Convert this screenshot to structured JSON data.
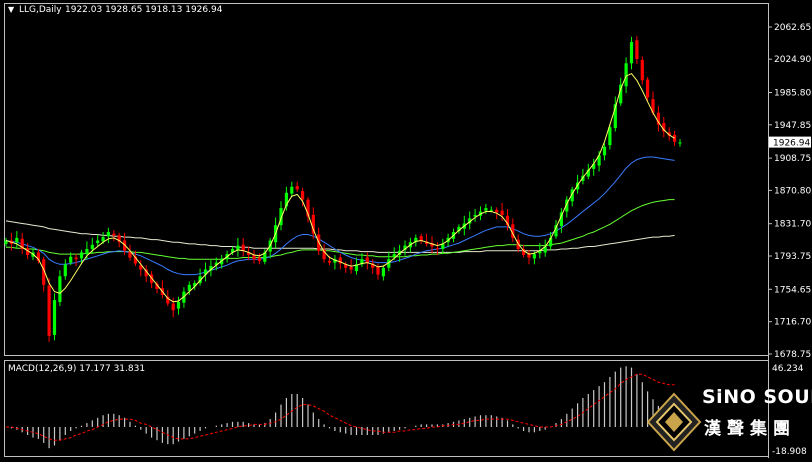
{
  "header": {
    "symbol_label": "LLG,Daily",
    "ohlc_text": "1922.03 1928.65 1918.13 1926.94",
    "menu_glyph": "▼"
  },
  "price_scale": {
    "ticks": [
      "2062.65",
      "2024.90",
      "1985.80",
      "1947.85",
      "1908.75",
      "1870.80",
      "1831.70",
      "1793.75",
      "1754.65",
      "1716.70",
      "1678.75"
    ],
    "current_price": "1926.94"
  },
  "macd": {
    "label": "MACD(12,26,9) 17.177 31.831",
    "scale_top": "46.234",
    "scale_bottom": "-18.908"
  },
  "watermark": {
    "title": "SiNO SOUND",
    "subtitle": "漢聲集團",
    "logo_icon": "diamond-logo-icon"
  },
  "colors": {
    "background": "#000000",
    "bull_candle": "#00ff00",
    "bear_candle": "#ff0000",
    "ma_fast": "#ffff66",
    "ma_blue": "#3a7bff",
    "ma_green": "#66ff33",
    "ma_slow": "#e8e8d0",
    "macd_signal": "#ff0000",
    "macd_hist": "#c8c8c8",
    "grid_border": "#c0c0c0"
  },
  "chart_data": {
    "type": "candlestick",
    "symbol": "LLG",
    "timeframe": "Daily",
    "ylim": [
      1678.75,
      2062.65
    ],
    "last": {
      "open": 1922.03,
      "high": 1928.65,
      "low": 1918.13,
      "close": 1926.94
    },
    "close_path": [
      1812,
      1808,
      1815,
      1802,
      1795,
      1798,
      1788,
      1760,
      1700,
      1742,
      1770,
      1784,
      1793,
      1790,
      1798,
      1802,
      1807,
      1812,
      1816,
      1822,
      1818,
      1810,
      1800,
      1792,
      1785,
      1778,
      1770,
      1762,
      1755,
      1748,
      1738,
      1730,
      1740,
      1752,
      1760,
      1762,
      1770,
      1778,
      1782,
      1786,
      1790,
      1796,
      1802,
      1806,
      1800,
      1795,
      1790,
      1788,
      1798,
      1812,
      1830,
      1850,
      1868,
      1875,
      1872,
      1860,
      1840,
      1820,
      1800,
      1790,
      1786,
      1790,
      1785,
      1780,
      1778,
      1784,
      1790,
      1786,
      1780,
      1772,
      1780,
      1790,
      1796,
      1800,
      1806,
      1810,
      1815,
      1812,
      1808,
      1805,
      1802,
      1808,
      1815,
      1822,
      1828,
      1832,
      1838,
      1842,
      1846,
      1850,
      1848,
      1845,
      1842,
      1830,
      1815,
      1802,
      1795,
      1792,
      1796,
      1800,
      1805,
      1815,
      1830,
      1845,
      1860,
      1872,
      1880,
      1888,
      1895,
      1902,
      1912,
      1922,
      1945,
      1972,
      1995,
      2020,
      2045,
      2025,
      2000,
      1980,
      1962,
      1948,
      1940,
      1935,
      1928,
      1927
    ],
    "ma_fast": [
      1812,
      1810,
      1808,
      1804,
      1800,
      1796,
      1790,
      1778,
      1762,
      1752,
      1750,
      1756,
      1765,
      1775,
      1785,
      1794,
      1800,
      1805,
      1810,
      1814,
      1815,
      1812,
      1807,
      1800,
      1792,
      1784,
      1776,
      1768,
      1760,
      1752,
      1744,
      1740,
      1741,
      1746,
      1752,
      1758,
      1765,
      1772,
      1778,
      1783,
      1788,
      1793,
      1798,
      1801,
      1800,
      1798,
      1795,
      1794,
      1797,
      1806,
      1820,
      1838,
      1854,
      1864,
      1866,
      1858,
      1843,
      1825,
      1810,
      1799,
      1792,
      1789,
      1787,
      1784,
      1782,
      1783,
      1785,
      1786,
      1784,
      1781,
      1782,
      1786,
      1791,
      1797,
      1802,
      1807,
      1811,
      1812,
      1810,
      1808,
      1806,
      1808,
      1812,
      1818,
      1824,
      1829,
      1834,
      1839,
      1843,
      1846,
      1846,
      1844,
      1840,
      1832,
      1820,
      1808,
      1800,
      1796,
      1797,
      1800,
      1805,
      1814,
      1827,
      1841,
      1855,
      1867,
      1877,
      1886,
      1894,
      1902,
      1912,
      1928,
      1948,
      1968,
      1990,
      2005,
      2008,
      2000,
      1988,
      1975,
      1962,
      1951,
      1942,
      1936,
      1932
    ],
    "ma_blue": [
      1812,
      1811,
      1810,
      1808,
      1806,
      1804,
      1801,
      1797,
      1790,
      1786,
      1784,
      1784,
      1785,
      1786,
      1788,
      1790,
      1792,
      1794,
      1796,
      1798,
      1799,
      1800,
      1799,
      1798,
      1796,
      1794,
      1791,
      1788,
      1785,
      1782,
      1778,
      1775,
      1773,
      1772,
      1772,
      1772,
      1773,
      1775,
      1777,
      1779,
      1781,
      1783,
      1786,
      1788,
      1789,
      1790,
      1790,
      1790,
      1791,
      1793,
      1797,
      1802,
      1808,
      1813,
      1817,
      1819,
      1819,
      1817,
      1814,
      1810,
      1806,
      1802,
      1798,
      1795,
      1792,
      1790,
      1789,
      1788,
      1787,
      1786,
      1786,
      1786,
      1787,
      1789,
      1791,
      1793,
      1796,
      1798,
      1800,
      1801,
      1802,
      1803,
      1805,
      1807,
      1809,
      1812,
      1815,
      1818,
      1821,
      1824,
      1826,
      1828,
      1828,
      1828,
      1826,
      1823,
      1820,
      1818,
      1817,
      1817,
      1818,
      1820,
      1823,
      1827,
      1831,
      1836,
      1841,
      1846,
      1851,
      1856,
      1861,
      1867,
      1874,
      1881,
      1889,
      1897,
      1903,
      1907,
      1909,
      1910,
      1910,
      1909,
      1908,
      1907,
      1906
    ],
    "ma_green": [
      1804,
      1804,
      1803,
      1803,
      1802,
      1802,
      1801,
      1800,
      1798,
      1797,
      1796,
      1796,
      1796,
      1796,
      1796,
      1797,
      1797,
      1798,
      1798,
      1799,
      1799,
      1799,
      1799,
      1799,
      1798,
      1798,
      1797,
      1796,
      1795,
      1794,
      1793,
      1792,
      1791,
      1791,
      1790,
      1790,
      1790,
      1790,
      1790,
      1790,
      1790,
      1791,
      1791,
      1791,
      1792,
      1792,
      1792,
      1792,
      1792,
      1793,
      1794,
      1795,
      1797,
      1798,
      1800,
      1801,
      1801,
      1801,
      1801,
      1800,
      1800,
      1799,
      1798,
      1797,
      1796,
      1795,
      1795,
      1794,
      1794,
      1793,
      1793,
      1793,
      1793,
      1793,
      1793,
      1794,
      1794,
      1795,
      1795,
      1796,
      1796,
      1797,
      1797,
      1798,
      1799,
      1800,
      1801,
      1802,
      1803,
      1804,
      1805,
      1806,
      1806,
      1807,
      1807,
      1807,
      1806,
      1806,
      1806,
      1806,
      1806,
      1807,
      1808,
      1809,
      1811,
      1813,
      1815,
      1817,
      1820,
      1822,
      1825,
      1828,
      1831,
      1835,
      1839,
      1843,
      1847,
      1850,
      1853,
      1855,
      1857,
      1858,
      1859,
      1860,
      1860
    ],
    "ma_slow": [
      1835,
      1834,
      1833,
      1832,
      1831,
      1830,
      1829,
      1828,
      1826,
      1825,
      1824,
      1823,
      1822,
      1821,
      1820,
      1820,
      1819,
      1819,
      1818,
      1818,
      1817,
      1817,
      1816,
      1816,
      1815,
      1815,
      1814,
      1813,
      1813,
      1812,
      1811,
      1810,
      1810,
      1809,
      1808,
      1808,
      1807,
      1807,
      1806,
      1806,
      1805,
      1805,
      1805,
      1804,
      1804,
      1804,
      1803,
      1803,
      1803,
      1803,
      1803,
      1803,
      1803,
      1803,
      1803,
      1803,
      1803,
      1803,
      1802,
      1802,
      1802,
      1801,
      1801,
      1800,
      1800,
      1800,
      1799,
      1799,
      1799,
      1798,
      1798,
      1798,
      1798,
      1798,
      1798,
      1798,
      1798,
      1798,
      1798,
      1798,
      1798,
      1798,
      1798,
      1798,
      1798,
      1799,
      1799,
      1799,
      1799,
      1800,
      1800,
      1800,
      1800,
      1800,
      1800,
      1800,
      1800,
      1800,
      1800,
      1800,
      1801,
      1801,
      1801,
      1802,
      1802,
      1803,
      1803,
      1804,
      1805,
      1805,
      1806,
      1807,
      1808,
      1809,
      1810,
      1811,
      1812,
      1813,
      1814,
      1815,
      1816,
      1816,
      1817,
      1817,
      1818
    ],
    "macd_ylim": [
      -18.908,
      46.234
    ],
    "macd_hist": [
      0,
      -1,
      -2,
      -4,
      -6,
      -8,
      -9,
      -12,
      -16,
      -14,
      -10,
      -6,
      -3,
      -1,
      1,
      3,
      5,
      7,
      9,
      10,
      10,
      9,
      7,
      4,
      1,
      -2,
      -5,
      -8,
      -10,
      -12,
      -13,
      -13,
      -11,
      -9,
      -7,
      -5,
      -3,
      -1,
      0,
      1,
      2,
      3,
      4,
      4,
      4,
      3,
      2,
      2,
      3,
      6,
      11,
      17,
      22,
      25,
      25,
      22,
      17,
      11,
      6,
      2,
      -1,
      -3,
      -4,
      -5,
      -6,
      -6,
      -6,
      -6,
      -6,
      -6,
      -5,
      -4,
      -3,
      -2,
      -1,
      0,
      1,
      2,
      2,
      2,
      2,
      2,
      3,
      4,
      5,
      6,
      7,
      8,
      9,
      9,
      9,
      8,
      7,
      5,
      2,
      -1,
      -3,
      -4,
      -4,
      -3,
      -2,
      0,
      3,
      6,
      10,
      14,
      18,
      22,
      25,
      28,
      31,
      34,
      38,
      42,
      45,
      46,
      45,
      40,
      34,
      27,
      21,
      16,
      12,
      9,
      7
    ],
    "macd_signal": [
      0,
      0,
      -1,
      -2,
      -3,
      -4,
      -5,
      -7,
      -9,
      -10,
      -10,
      -9,
      -8,
      -6,
      -5,
      -3,
      -2,
      0,
      2,
      4,
      5,
      6,
      6,
      6,
      5,
      3,
      2,
      0,
      -2,
      -4,
      -6,
      -8,
      -9,
      -9,
      -9,
      -8,
      -7,
      -6,
      -5,
      -4,
      -3,
      -2,
      -1,
      0,
      1,
      1,
      2,
      2,
      2,
      3,
      4,
      6,
      9,
      12,
      15,
      17,
      17,
      16,
      14,
      12,
      9,
      7,
      5,
      3,
      1,
      0,
      -1,
      -2,
      -3,
      -3,
      -4,
      -4,
      -4,
      -3,
      -3,
      -2,
      -2,
      -1,
      -1,
      0,
      0,
      1,
      1,
      2,
      2,
      3,
      4,
      5,
      5,
      6,
      6,
      6,
      6,
      6,
      5,
      4,
      3,
      2,
      1,
      0,
      0,
      0,
      1,
      2,
      4,
      6,
      8,
      11,
      14,
      17,
      20,
      23,
      26,
      29,
      33,
      36,
      38,
      40,
      40,
      38,
      36,
      34,
      33,
      32,
      32
    ]
  }
}
